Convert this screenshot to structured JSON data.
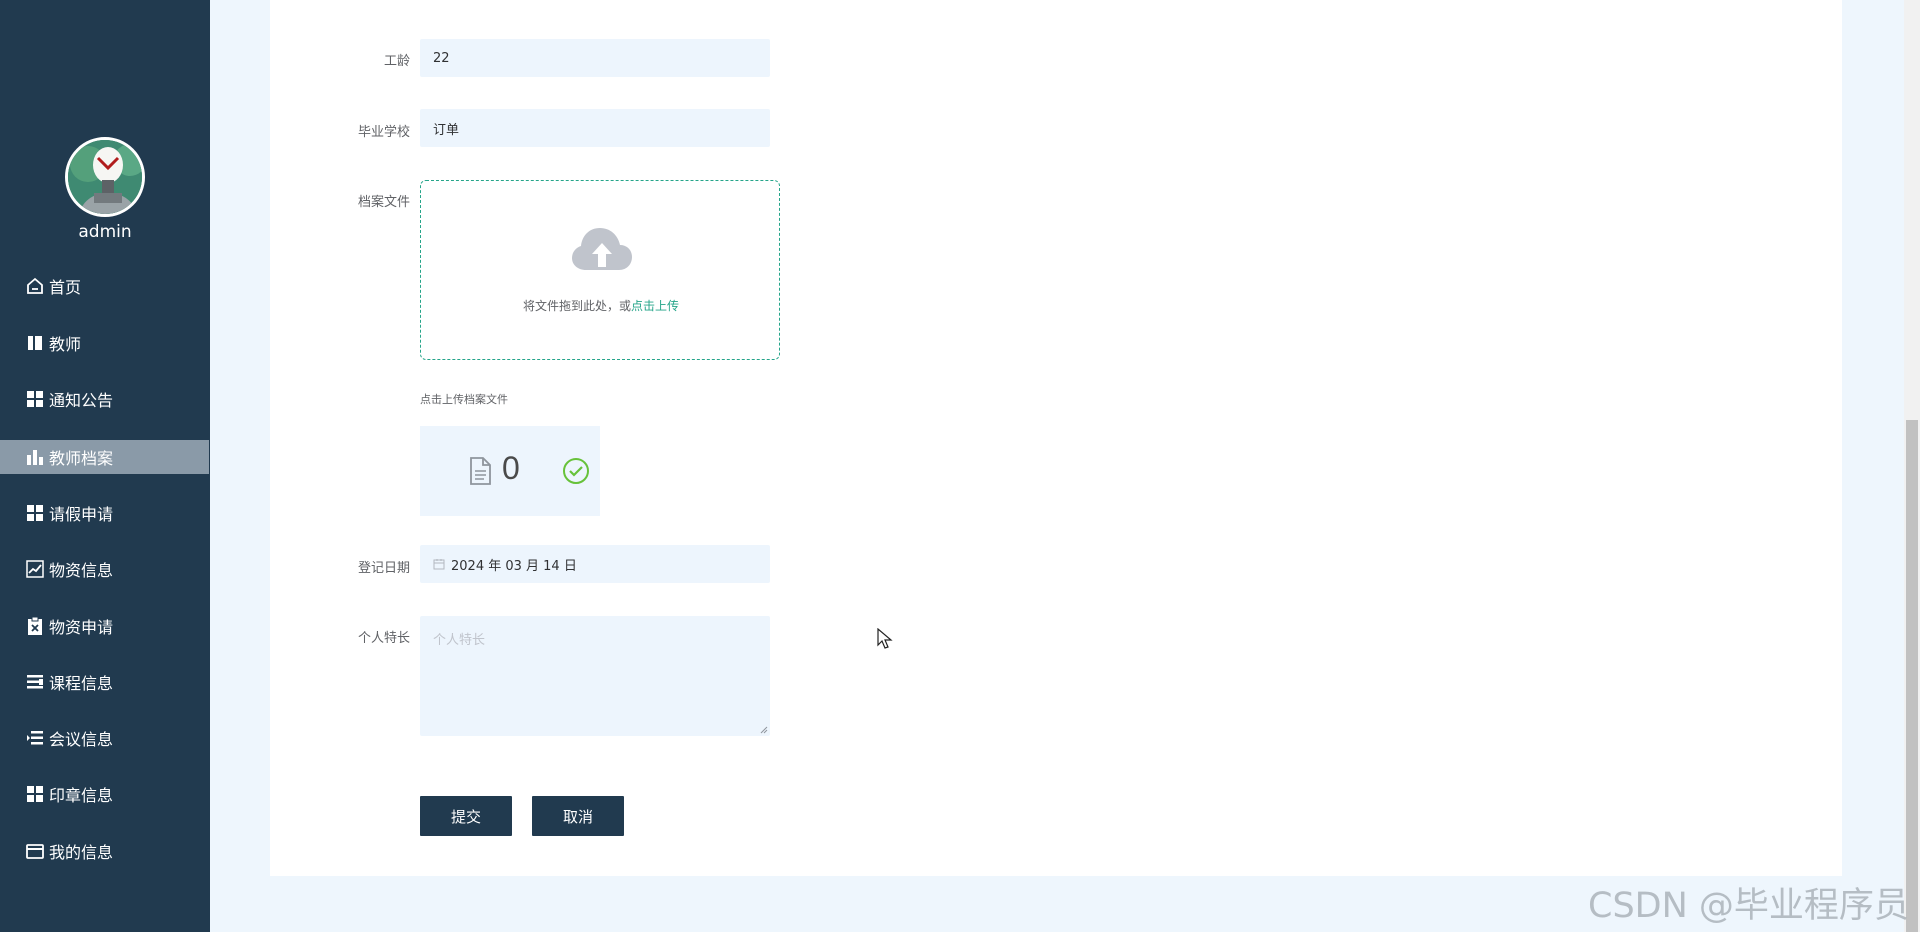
{
  "sidebar": {
    "username": "admin",
    "items": [
      {
        "label": "首页",
        "icon": "home-icon",
        "active": false
      },
      {
        "label": "教师",
        "icon": "book-icon",
        "active": false
      },
      {
        "label": "通知公告",
        "icon": "grid-icon",
        "active": false
      },
      {
        "label": "教师档案",
        "icon": "bar-chart-icon",
        "active": true
      },
      {
        "label": "请假申请",
        "icon": "grid-icon",
        "active": false
      },
      {
        "label": "物资信息",
        "icon": "line-chart-icon",
        "active": false
      },
      {
        "label": "物资申请",
        "icon": "clipboard-icon",
        "active": false
      },
      {
        "label": "课程信息",
        "icon": "list-icon",
        "active": false
      },
      {
        "label": "会议信息",
        "icon": "list-indent-icon",
        "active": false
      },
      {
        "label": "印章信息",
        "icon": "grid-icon",
        "active": false
      },
      {
        "label": "我的信息",
        "icon": "id-card-icon",
        "active": false
      }
    ]
  },
  "form": {
    "years_label": "工龄",
    "years_value": "22",
    "school_label": "毕业学校",
    "school_value": "订单",
    "file_label": "档案文件",
    "upload_text": "将文件拖到此处，或",
    "upload_link": "点击上传",
    "upload_tip": "点击上传档案文件",
    "file_count": "0",
    "date_label": "登记日期",
    "date_value": "2024 年 03 月 14 日",
    "specialty_label": "个人特长",
    "specialty_placeholder": "个人特长",
    "submit_label": "提交",
    "cancel_label": "取消"
  },
  "watermark": "CSDN @毕业程序员",
  "colors": {
    "sidebar_bg": "#213a4f",
    "active_item_bg": "#8a9aa8",
    "accent": "#26a58a",
    "input_bg": "#edf5fd",
    "success": "#67c23a"
  }
}
